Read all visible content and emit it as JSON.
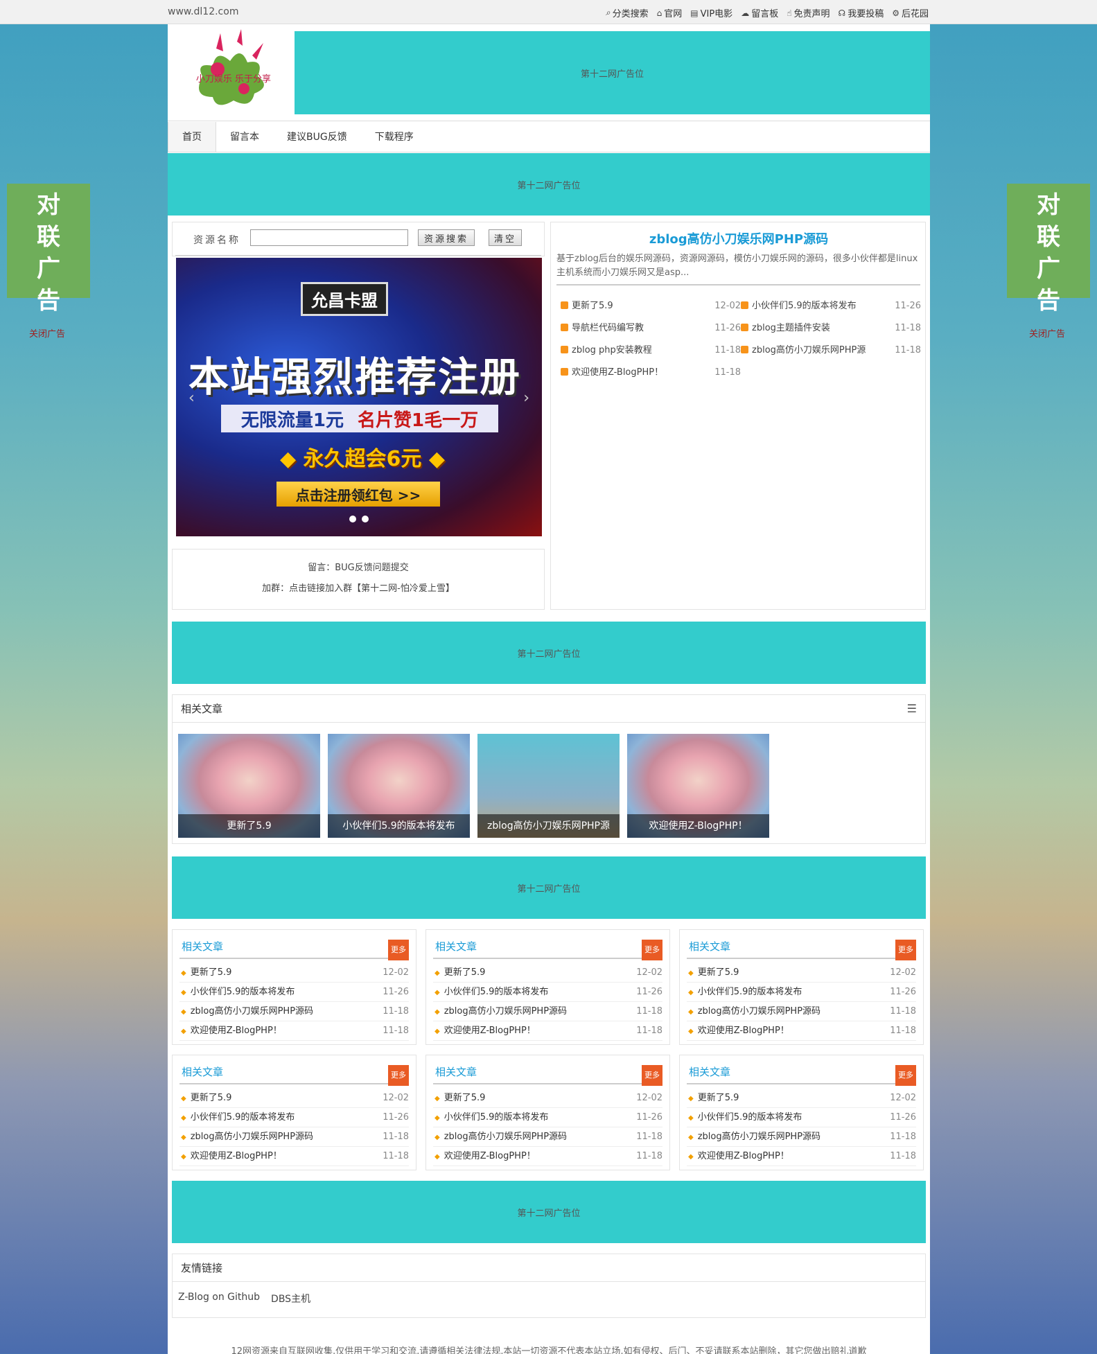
{
  "topbar": {
    "site": "www.dl12.com",
    "links": [
      {
        "icon": "search-icon",
        "label": "分类搜索"
      },
      {
        "icon": "home-icon",
        "label": "官网"
      },
      {
        "icon": "film-icon",
        "label": "VIP电影"
      },
      {
        "icon": "cloud-icon",
        "label": "留言板"
      },
      {
        "icon": "thumbs-up-icon",
        "label": "免责声明"
      },
      {
        "icon": "headphones-icon",
        "label": "我要投稿"
      },
      {
        "icon": "gear-icon",
        "label": "后花园"
      }
    ]
  },
  "header": {
    "logo_text": "小刀娱乐 乐于分享",
    "ad_text": "第十二网广告位"
  },
  "nav": [
    "首页",
    "留言本",
    "建议BUG反馈",
    "下载程序"
  ],
  "ads": {
    "text": "第十二网广告位"
  },
  "search": {
    "label": "资源名称",
    "placeholder": "",
    "search_btn": "资源搜索",
    "clear_btn": "清空"
  },
  "banner": {
    "line1": "允昌卡盟",
    "line2": "本站强烈推荐注册",
    "line3a": "无限流量1元",
    "line3b": "名片赞1毛一万",
    "line4": "永久超会6元",
    "line5": "点击注册领红包 >>"
  },
  "notice": {
    "line1": "留言：BUG反馈问题提交",
    "line2": "加群：点击链接加入群【第十二网-怕冷爱上雪】"
  },
  "feature": {
    "title": "zblog高仿小刀娱乐网PHP源码",
    "desc": "基于zblog后台的娱乐网源码，资源网源码，模仿小刀娱乐网的源码，很多小伙伴都是linux主机系统而小刀娱乐网又是asp...",
    "left": [
      {
        "title": "更新了5.9",
        "date": "12-02"
      },
      {
        "title": "导航栏代码编写教",
        "date": "11-26"
      },
      {
        "title": "zblog php安装教程",
        "date": "11-18"
      },
      {
        "title": "欢迎使用Z-BlogPHP！",
        "date": "11-18"
      }
    ],
    "right": [
      {
        "title": "小伙伴们5.9的版本将发布",
        "date": "11-26"
      },
      {
        "title": "zblog主题插件安装",
        "date": "11-18"
      },
      {
        "title": "zblog高仿小刀娱乐网PHP源",
        "date": "11-18"
      }
    ]
  },
  "related": {
    "title": "相关文章",
    "items": [
      "更新了5.9",
      "小伙伴们5.9的版本将发布",
      "zblog高仿小刀娱乐网PHP源",
      "欢迎使用Z-BlogPHP！"
    ]
  },
  "mini": {
    "title": "相关文章",
    "more": "更多",
    "items": [
      {
        "title": "更新了5.9",
        "date": "12-02"
      },
      {
        "title": "小伙伴们5.9的版本将发布",
        "date": "11-26"
      },
      {
        "title": "zblog高仿小刀娱乐网PHP源码",
        "date": "11-18"
      },
      {
        "title": "欢迎使用Z-BlogPHP！",
        "date": "11-18"
      }
    ]
  },
  "friend": {
    "title": "友情链接",
    "links": [
      "Z-Blog on Github",
      "DBS主机"
    ]
  },
  "footer": {
    "text": "12网资源来自互联网收集,仅供用于学习和交流,请遵循相关法律法规,本站一切资源不代表本站立场,如有侵权、后门、不妥请联系本站删除，其它您做出赔礼道歉"
  },
  "couplet": {
    "text": "对联广告",
    "close": "关闭广告"
  }
}
